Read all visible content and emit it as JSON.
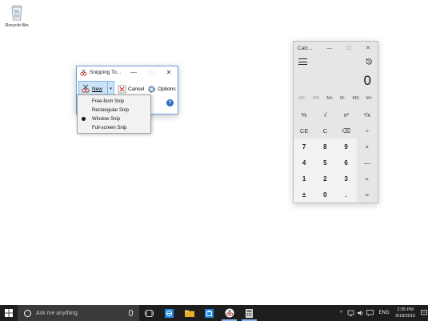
{
  "desktop": {
    "recycle_bin_label": "Recycle Bin"
  },
  "snipping_tool": {
    "title": "Snipping To...",
    "new_label": "New",
    "cancel_label": "Cancel",
    "options_label": "Options",
    "help_symbol": "?",
    "minimize_symbol": "—",
    "maximize_symbol": "□",
    "close_symbol": "✕",
    "dropdown_arrow": "▾"
  },
  "snip_menu": {
    "items": [
      {
        "label": "Free-form Snip",
        "selected": false
      },
      {
        "label": "Rectangular Snip",
        "selected": false
      },
      {
        "label": "Window Snip",
        "selected": true
      },
      {
        "label": "Full-screen Snip",
        "selected": false
      }
    ]
  },
  "calculator": {
    "title": "Calc...",
    "display_value": "0",
    "minimize_symbol": "—",
    "maximize_symbol": "□",
    "close_symbol": "✕",
    "memory_buttons": [
      "MC",
      "MR",
      "M+",
      "M-",
      "MS",
      "M˅"
    ],
    "keys": [
      "%",
      "√",
      "x²",
      "¹/x",
      "CE",
      "C",
      "⌫",
      "÷",
      "7",
      "8",
      "9",
      "×",
      "4",
      "5",
      "6",
      "—",
      "1",
      "2",
      "3",
      "+",
      "±",
      "0",
      ".",
      "="
    ]
  },
  "taskbar": {
    "search_placeholder": "Ask me anything",
    "language": "ENG",
    "time": "2:35 PM",
    "date": "6/18/2015"
  },
  "colors": {
    "taskbar_bg": "#1e1e1e",
    "search_bg": "#3a3a3a",
    "accent_blue": "#0078d7",
    "snip_new_highlight": "#cce4f7"
  }
}
